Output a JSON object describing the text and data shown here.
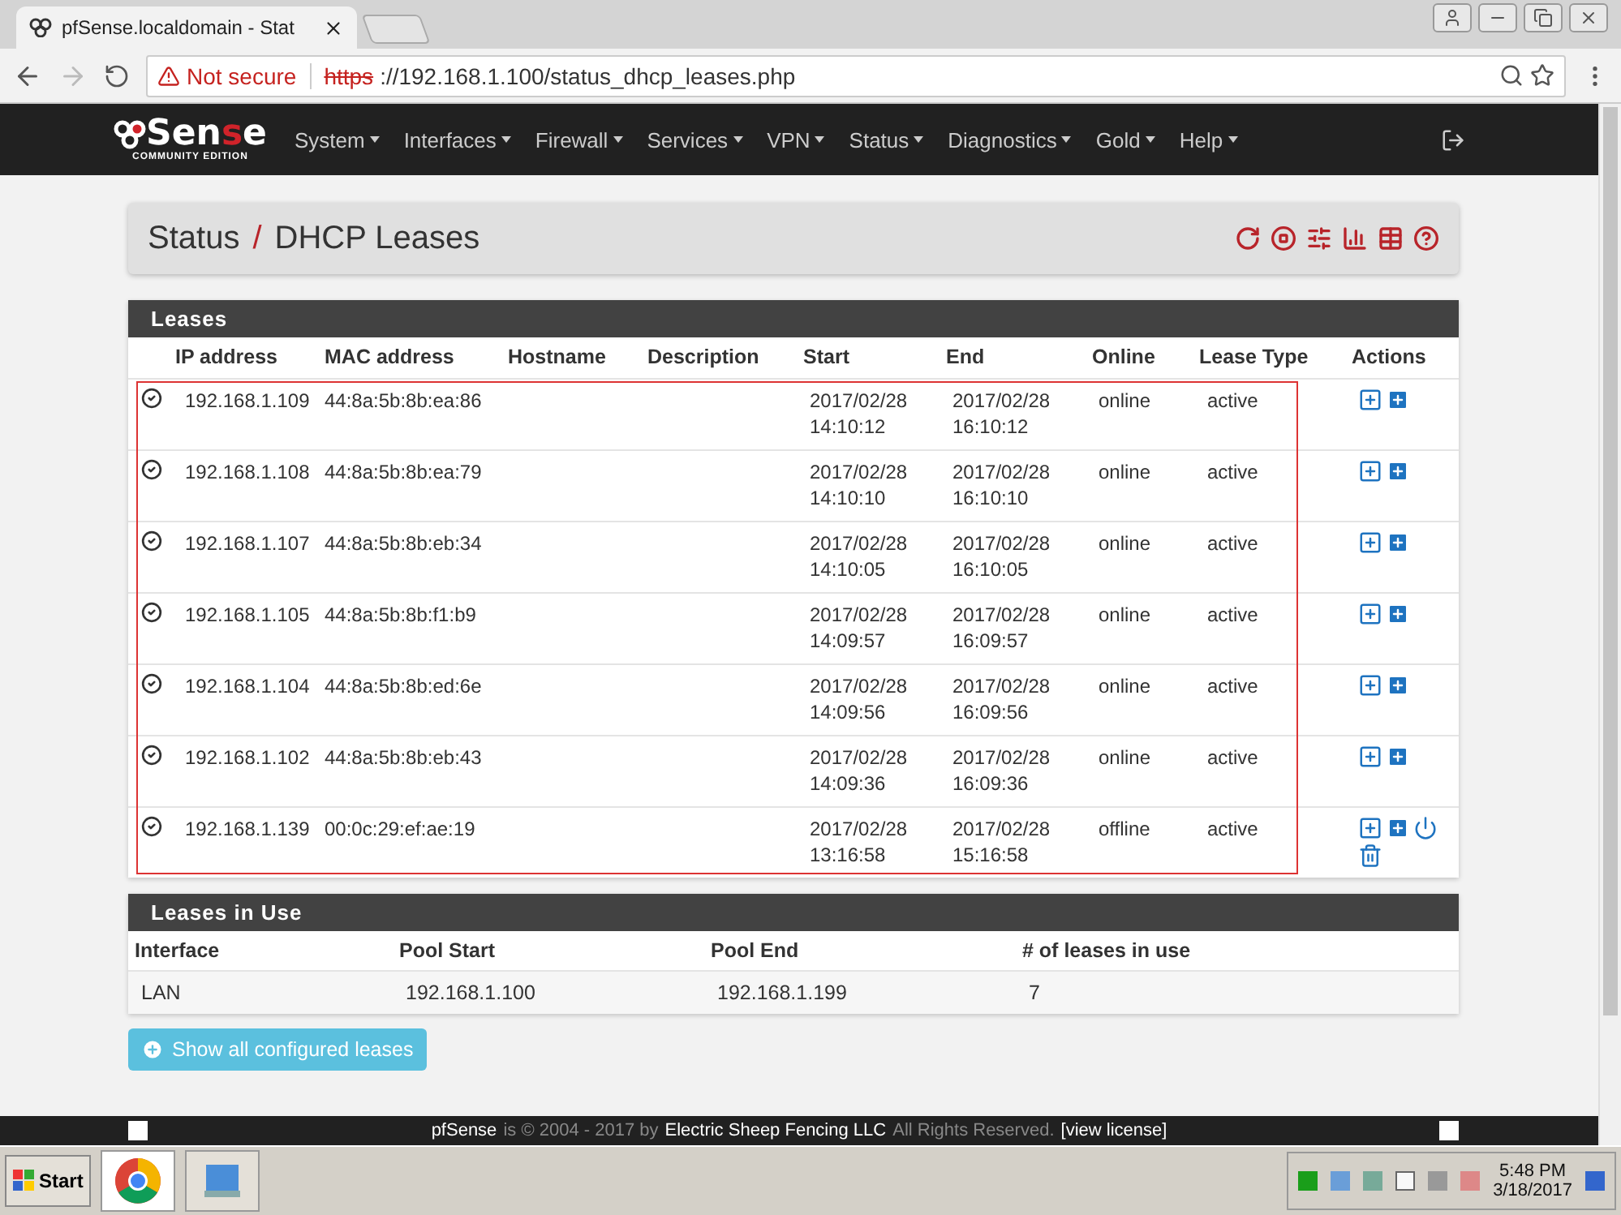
{
  "browser": {
    "tab_title": "pfSense.localdomain - Stat",
    "security": "Not secure",
    "url_scheme": "https",
    "url_rest": "://192.168.1.100/status_dhcp_leases.php"
  },
  "logo": {
    "parts": [
      {
        "text": "Sen",
        "accent": false
      },
      {
        "text": "s",
        "accent": true
      },
      {
        "text": "e",
        "accent": false
      }
    ],
    "subtitle": "COMMUNITY EDITION"
  },
  "nav": [
    "System",
    "Interfaces",
    "Firewall",
    "Services",
    "VPN",
    "Status",
    "Diagnostics",
    "Gold",
    "Help"
  ],
  "breadcrumb": {
    "parent": "Status",
    "separator": "/",
    "current": "DHCP Leases"
  },
  "leases": {
    "title": "Leases",
    "highlight": true,
    "columns": [
      "IP address",
      "MAC address",
      "Hostname",
      "Description",
      "Start",
      "End",
      "Online",
      "Lease Type",
      "Actions"
    ],
    "rows": [
      {
        "ip": "192.168.1.109",
        "mac": "44:8a:5b:8b:ea:86",
        "start": [
          "2017/02/28",
          "14:10:12"
        ],
        "end": [
          "2017/02/28",
          "16:10:12"
        ],
        "online": "online",
        "type": "active",
        "actions": [
          {
            "kind": "add-mapping"
          },
          {
            "kind": "add-wol"
          }
        ]
      },
      {
        "ip": "192.168.1.108",
        "mac": "44:8a:5b:8b:ea:79",
        "start": [
          "2017/02/28",
          "14:10:10"
        ],
        "end": [
          "2017/02/28",
          "16:10:10"
        ],
        "online": "online",
        "type": "active",
        "actions": [
          {
            "kind": "add-mapping"
          },
          {
            "kind": "add-wol"
          }
        ]
      },
      {
        "ip": "192.168.1.107",
        "mac": "44:8a:5b:8b:eb:34",
        "start": [
          "2017/02/28",
          "14:10:05"
        ],
        "end": [
          "2017/02/28",
          "16:10:05"
        ],
        "online": "online",
        "type": "active",
        "actions": [
          {
            "kind": "add-mapping"
          },
          {
            "kind": "add-wol"
          }
        ]
      },
      {
        "ip": "192.168.1.105",
        "mac": "44:8a:5b:8b:f1:b9",
        "start": [
          "2017/02/28",
          "14:09:57"
        ],
        "end": [
          "2017/02/28",
          "16:09:57"
        ],
        "online": "online",
        "type": "active",
        "actions": [
          {
            "kind": "add-mapping"
          },
          {
            "kind": "add-wol"
          }
        ]
      },
      {
        "ip": "192.168.1.104",
        "mac": "44:8a:5b:8b:ed:6e",
        "start": [
          "2017/02/28",
          "14:09:56"
        ],
        "end": [
          "2017/02/28",
          "16:09:56"
        ],
        "online": "online",
        "type": "active",
        "actions": [
          {
            "kind": "add-mapping"
          },
          {
            "kind": "add-wol"
          }
        ]
      },
      {
        "ip": "192.168.1.102",
        "mac": "44:8a:5b:8b:eb:43",
        "start": [
          "2017/02/28",
          "14:09:36"
        ],
        "end": [
          "2017/02/28",
          "16:09:36"
        ],
        "online": "online",
        "type": "active",
        "actions": [
          {
            "kind": "add-mapping"
          },
          {
            "kind": "add-wol"
          }
        ]
      },
      {
        "ip": "192.168.1.139",
        "mac": "00:0c:29:ef:ae:19",
        "start": [
          "2017/02/28",
          "13:16:58"
        ],
        "end": [
          "2017/02/28",
          "15:16:58"
        ],
        "online": "offline",
        "type": "active",
        "actions": [
          {
            "kind": "add-mapping"
          },
          {
            "kind": "add-wol"
          },
          {
            "kind": "wake"
          },
          {
            "kind": "delete"
          }
        ]
      }
    ]
  },
  "in_use": {
    "title": "Leases in Use",
    "columns": [
      "Interface",
      "Pool Start",
      "Pool End",
      "# of leases in use"
    ],
    "rows": [
      [
        "LAN",
        "192.168.1.100",
        "192.168.1.199",
        "7"
      ]
    ]
  },
  "show_all_button": "Show all configured leases",
  "footer": {
    "brand": "pfSense",
    "text_1": "is © 2004 - 2017 by",
    "company": "Electric Sheep Fencing LLC",
    "text_2": "All Rights Reserved.",
    "license": "[view license]"
  },
  "taskbar": {
    "start": "Start",
    "time": "5:48 PM",
    "date": "3/18/2017"
  }
}
